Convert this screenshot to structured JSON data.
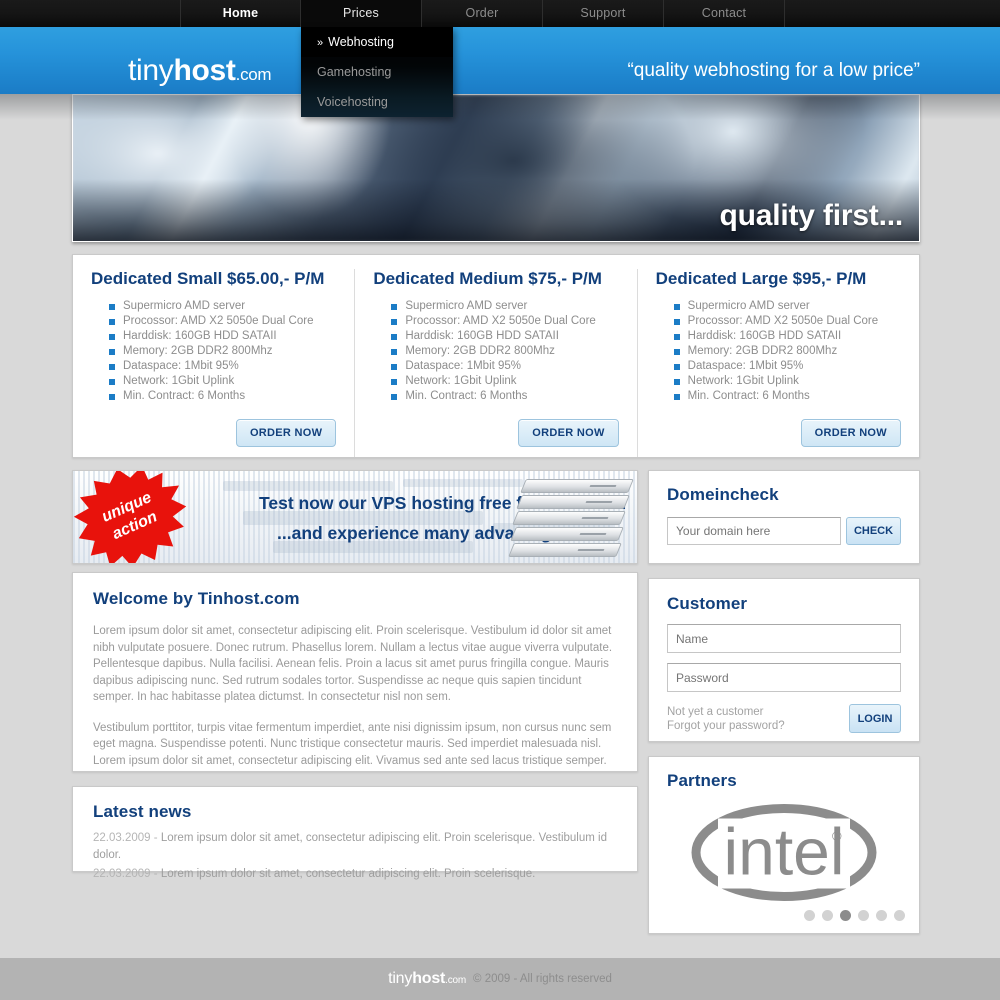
{
  "nav": {
    "items": [
      {
        "label": "Home",
        "state": "active"
      },
      {
        "label": "Prices",
        "state": "open"
      },
      {
        "label": "Order",
        "state": "normal"
      },
      {
        "label": "Support",
        "state": "normal"
      },
      {
        "label": "Contact",
        "state": "normal"
      }
    ]
  },
  "dropdown": {
    "arrow": "»",
    "items": [
      {
        "label": "Webhosting",
        "state": "active"
      },
      {
        "label": "Gamehosting",
        "state": "normal"
      },
      {
        "label": "Voicehosting",
        "state": "normal"
      }
    ]
  },
  "header": {
    "logo_thin": "tiny",
    "logo_bold": "host",
    "logo_tld": ".com",
    "tagline": "“quality webhosting for a low price”"
  },
  "hero": {
    "caption": "quality first..."
  },
  "plans": [
    {
      "title": "Dedicated Small  $65.00,- P/M",
      "features": [
        "Supermicro AMD server",
        "Procossor: AMD X2 5050e Dual Core",
        "Harddisk: 160GB HDD SATAII",
        "Memory: 2GB DDR2 800Mhz",
        "Dataspace: 1Mbit 95%",
        "Network: 1Gbit Uplink",
        "Min. Contract: 6 Months"
      ],
      "button": "ORDER NOW"
    },
    {
      "title": "Dedicated Medium $75,- P/M",
      "features": [
        "Supermicro AMD server",
        "Procossor: AMD X2 5050e Dual Core",
        "Harddisk: 160GB HDD SATAII",
        "Memory: 2GB DDR2 800Mhz",
        "Dataspace: 1Mbit 95%",
        "Network: 1Gbit Uplink",
        "Min. Contract: 6 Months"
      ],
      "button": "ORDER NOW"
    },
    {
      "title": "Dedicated Large $95,- P/M",
      "features": [
        "Supermicro AMD server",
        "Procossor: AMD X2 5050e Dual Core",
        "Harddisk: 160GB HDD SATAII",
        "Memory: 2GB DDR2 800Mhz",
        "Dataspace: 1Mbit 95%",
        "Network: 1Gbit Uplink",
        "Min. Contract: 6 Months"
      ],
      "button": "ORDER NOW"
    }
  ],
  "promo": {
    "badge_line1": "unique",
    "badge_line2": "action",
    "line1": "Test now our VPS hosting free for 3 weeks...",
    "line2": "...and experience many advantages!"
  },
  "domeincheck": {
    "title": "Domeincheck",
    "placeholder": "Your domain here",
    "value": "",
    "button": "CHECK"
  },
  "welcome": {
    "title": "Welcome by Tinhost.com",
    "paragraphs": [
      "Lorem ipsum dolor sit amet, consectetur adipiscing elit. Proin scelerisque. Vestibulum id dolor sit amet nibh vulputate posuere. Donec rutrum. Phasellus lorem. Nullam a lectus vitae augue viverra vulputate. Pellentesque dapibus. Nulla facilisi. Aenean felis. Proin a lacus sit amet purus fringilla congue. Mauris dapibus adipiscing nunc. Sed rutrum sodales tortor. Suspendisse ac neque quis sapien tincidunt semper. In hac habitasse platea dictumst. In consectetur nisl non sem.",
      "Vestibulum porttitor, turpis vitae fermentum imperdiet, ante nisi dignissim ipsum, non cursus nunc sem eget magna. Suspendisse potenti. Nunc tristique consectetur mauris. Sed imperdiet malesuada nisl. Lorem ipsum dolor sit amet, consectetur adipiscing elit. Vivamus sed ante sed lacus tristique semper. Pellentesque"
    ]
  },
  "customer": {
    "title": "Customer",
    "name_placeholder": "Name",
    "name_value": "",
    "password_placeholder": "Password",
    "password_value": "",
    "link_signup": "Not yet a customer",
    "link_forgot": "Forgot your password?",
    "button": "LOGIN"
  },
  "news": {
    "title": "Latest news",
    "items": [
      {
        "date": "22.03.2009",
        "sep": "-",
        "text": "Lorem ipsum dolor sit amet, consectetur adipiscing elit. Proin scelerisque. Vestibulum id dolor."
      },
      {
        "date": "22.03.2009",
        "sep": "-",
        "text": "Lorem ipsum dolor sit amet, consectetur adipiscing elit. Proin scelerisque."
      }
    ]
  },
  "partners": {
    "title": "Partners",
    "logo_name": "intel",
    "logo_mark": "®",
    "dots": [
      {
        "active": false
      },
      {
        "active": false
      },
      {
        "active": true
      },
      {
        "active": false
      },
      {
        "active": false
      },
      {
        "active": false
      }
    ]
  },
  "footer": {
    "logo_thin": "tiny",
    "logo_bold": "host",
    "logo_tld": ".com",
    "copyright": "© 2009 - All rights reserved"
  },
  "colors": {
    "brand_blue": "#1b7cc6",
    "heading_navy": "#12407c",
    "page_bg": "#d9d9d9",
    "promo_red": "#e8120c",
    "footer_bg": "#b3b3b3"
  }
}
